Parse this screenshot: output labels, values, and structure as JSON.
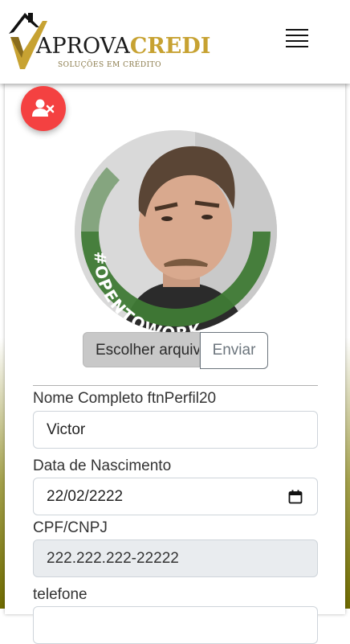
{
  "header": {
    "logo_word_a": "APROVA",
    "logo_word_b": "CREDI",
    "logo_subtitle": "SOLUÇÕES EM CRÉDITO"
  },
  "profile": {
    "badge_text": "#OPENTOWORK"
  },
  "upload": {
    "choose_label": "Escolher arquivo",
    "send_label": "Enviar"
  },
  "form": {
    "name_label": "Nome Completo ftnPerfil20",
    "name_value": "Victor",
    "birth_label": "Data de Nascimento",
    "birth_value": "22/02/2222",
    "cpf_label": "CPF/CNPJ",
    "cpf_value": "222.222.222-22222",
    "phone_label": "telefone"
  },
  "colors": {
    "accent_red": "#f44141",
    "brand_gold": "#c7a232",
    "opentowork_green": "#3f7a35"
  }
}
